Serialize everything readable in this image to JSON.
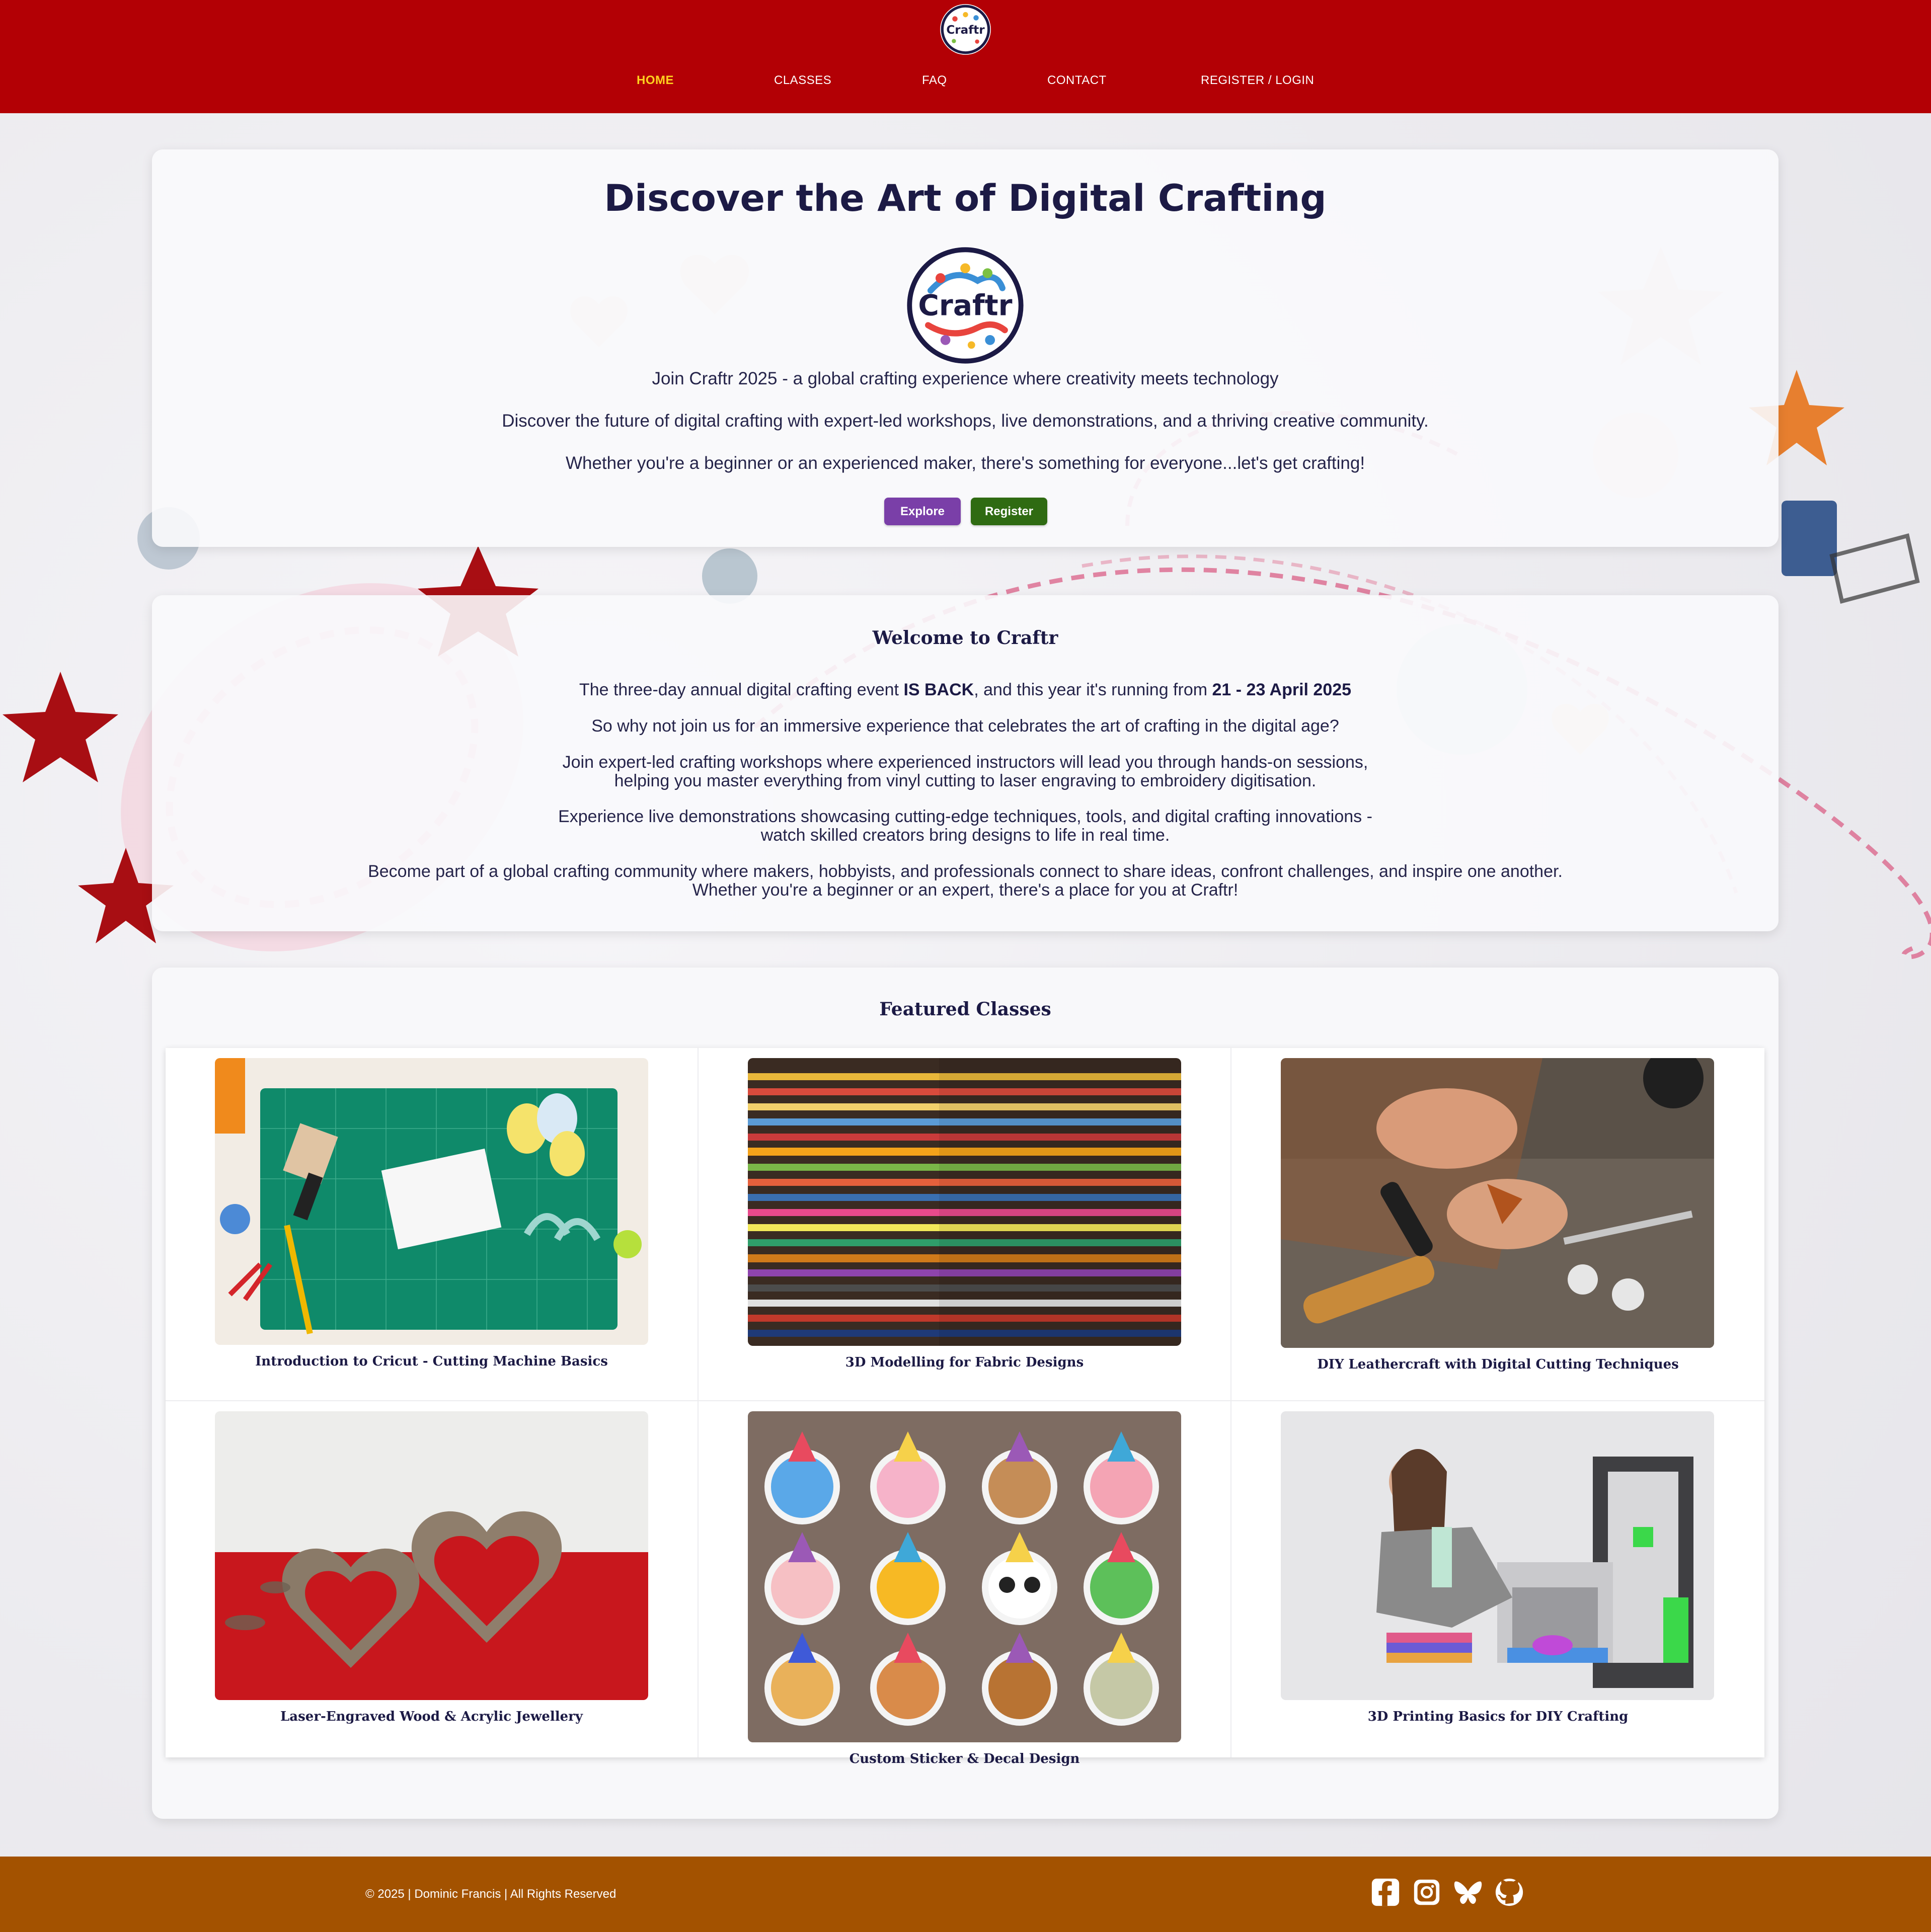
{
  "brand": {
    "name": "Craftr"
  },
  "colors": {
    "header": "#b30005",
    "nav_active": "#ffd21f",
    "title": "#1c1a45",
    "explore_button": "#7a3fa8",
    "register_button": "#2f6b12",
    "footer": "#a35200"
  },
  "nav": {
    "items": [
      {
        "label": "HOME",
        "active": true
      },
      {
        "label": "CLASSES"
      },
      {
        "label": "FAQ"
      },
      {
        "label": "CONTACT"
      },
      {
        "label": "REGISTER / LOGIN"
      }
    ]
  },
  "hero": {
    "title": "Discover the Art of Digital Crafting",
    "line1": "Join Craftr 2025 - a global crafting experience where creativity meets technology",
    "line2": "Discover the future of digital crafting with expert-led workshops, live demonstrations, and a thriving creative community.",
    "line3": "Whether you're a beginner or an experienced maker, there's something for everyone...let's get crafting!",
    "explore_label": "Explore",
    "register_label": "Register"
  },
  "welcome": {
    "title": "Welcome to Craftr",
    "p1_before": "The three-day annual digital crafting event ",
    "p1_bold1": "IS BACK",
    "p1_middle": ", and this year it's running from ",
    "p1_bold2": "21 - 23 April 2025",
    "p2": "So why not join us for an immersive experience that celebrates the art of crafting in the digital age?",
    "p3a": "Join expert-led crafting workshops where experienced instructors will lead you through hands-on sessions,",
    "p3b": "helping you master everything from vinyl cutting to laser engraving to embroidery digitisation.",
    "p4a": "Experience live demonstrations showcasing cutting-edge techniques, tools, and digital crafting innovations -",
    "p4b": "watch skilled creators bring designs to life in real time.",
    "p5a": "Become part of a global crafting community where makers, hobbyists, and professionals connect to share ideas, confront challenges, and inspire one another.",
    "p5b": "Whether you're a beginner or an expert, there's a place for you at Craftr!"
  },
  "featured": {
    "title": "Featured Classes",
    "classes": [
      {
        "title": "Introduction to Cricut - Cutting Machine Basics",
        "image": "cutting-mat-photo"
      },
      {
        "title": "3D Modelling for Fabric Designs",
        "image": "fabric-shelves-photo"
      },
      {
        "title": "DIY Leathercraft with Digital Cutting Techniques",
        "image": "leathercraft-photo"
      },
      {
        "title": "Laser-Engraved Wood & Acrylic Jewellery",
        "image": "wooden-hearts-photo"
      },
      {
        "title": "Custom Sticker & Decal Design",
        "image": "animal-stickers-photo"
      },
      {
        "title": "3D Printing Basics for DIY Crafting",
        "image": "3d-printer-photo"
      }
    ]
  },
  "footer": {
    "copyright": "© 2025 | Dominic Francis | All Rights Reserved",
    "social": [
      "facebook-icon",
      "instagram-icon",
      "bluesky-icon",
      "github-icon"
    ]
  }
}
